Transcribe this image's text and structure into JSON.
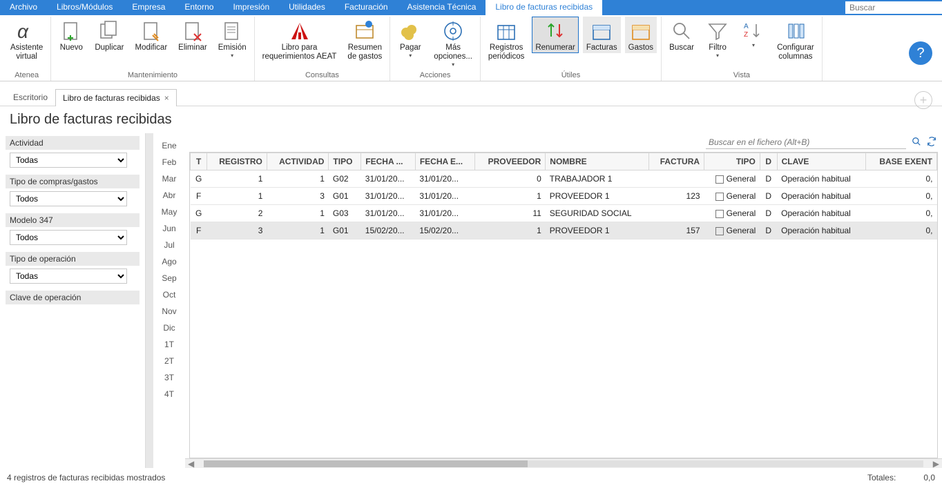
{
  "menubar": {
    "items": [
      "Archivo",
      "Libros/Módulos",
      "Empresa",
      "Entorno",
      "Impresión",
      "Utilidades",
      "Facturación",
      "Asistencia Técnica"
    ],
    "active_tab": "Libro de facturas recibidas",
    "search_placeholder": "Buscar"
  },
  "ribbon": {
    "groups": [
      {
        "label": "Atenea",
        "buttons": [
          {
            "id": "asistente",
            "label": "Asistente\nvirtual"
          }
        ]
      },
      {
        "label": "Mantenimiento",
        "buttons": [
          {
            "id": "nuevo",
            "label": "Nuevo"
          },
          {
            "id": "duplicar",
            "label": "Duplicar"
          },
          {
            "id": "modificar",
            "label": "Modificar"
          },
          {
            "id": "eliminar",
            "label": "Eliminar"
          },
          {
            "id": "emision",
            "label": "Emisión",
            "dd": true
          }
        ]
      },
      {
        "label": "Consultas",
        "buttons": [
          {
            "id": "aeat",
            "label": "Libro para\nrequerimientos AEAT"
          },
          {
            "id": "resumen",
            "label": "Resumen\nde gastos"
          }
        ]
      },
      {
        "label": "Acciones",
        "buttons": [
          {
            "id": "pagar",
            "label": "Pagar",
            "dd": true
          },
          {
            "id": "mas",
            "label": "Más\nopciones...",
            "dd": true
          }
        ]
      },
      {
        "label": "Útiles",
        "buttons": [
          {
            "id": "periodicos",
            "label": "Registros\nperiódicos"
          },
          {
            "id": "renumerar",
            "label": "Renumerar",
            "focus": true
          },
          {
            "id": "facturas",
            "label": "Facturas",
            "focus2": true
          },
          {
            "id": "gastos",
            "label": "Gastos",
            "focus2": true
          }
        ]
      },
      {
        "label": "Vista",
        "buttons": [
          {
            "id": "buscar",
            "label": "Buscar"
          },
          {
            "id": "filtro",
            "label": "Filtro",
            "dd": true
          },
          {
            "id": "orden",
            "label": "",
            "dd": true,
            "icononly": "sort"
          },
          {
            "id": "config",
            "label": "Configurar\ncolumnas"
          }
        ]
      }
    ]
  },
  "doc_tabs": {
    "items": [
      {
        "label": "Escritorio",
        "active": false,
        "closable": false
      },
      {
        "label": "Libro de facturas recibidas",
        "active": true,
        "closable": true
      }
    ]
  },
  "page_title": "Libro de facturas recibidas",
  "filters": [
    {
      "label": "Actividad",
      "value": "Todas"
    },
    {
      "label": "Tipo de compras/gastos",
      "value": "Todos"
    },
    {
      "label": "Modelo 347",
      "value": "Todos"
    },
    {
      "label": "Tipo de operación",
      "value": "Todas"
    },
    {
      "label": "Clave de operación",
      "value": ""
    }
  ],
  "months": [
    "Ene",
    "Feb",
    "Mar",
    "Abr",
    "May",
    "Jun",
    "Jul",
    "Ago",
    "Sep",
    "Oct",
    "Nov",
    "Dic",
    "1T",
    "2T",
    "3T",
    "4T"
  ],
  "file_search": {
    "placeholder": "Buscar en el fichero (Alt+B)"
  },
  "grid": {
    "columns": [
      {
        "key": "t",
        "label": "T",
        "align": "c"
      },
      {
        "key": "registro",
        "label": "REGISTRO",
        "align": "r"
      },
      {
        "key": "actividad",
        "label": "ACTIVIDAD",
        "align": "r"
      },
      {
        "key": "tipo",
        "label": "TIPO"
      },
      {
        "key": "fecha",
        "label": "FECHA ..."
      },
      {
        "key": "fechae",
        "label": "FECHA E..."
      },
      {
        "key": "proveedor",
        "label": "PROVEEDOR",
        "align": "r"
      },
      {
        "key": "nombre",
        "label": "NOMBRE"
      },
      {
        "key": "factura",
        "label": "FACTURA",
        "align": "r"
      },
      {
        "key": "tipol",
        "label": "TIPO",
        "align": "r"
      },
      {
        "key": "d",
        "label": "D",
        "align": "c"
      },
      {
        "key": "clave",
        "label": "CLAVE"
      },
      {
        "key": "base",
        "label": "BASE EXENT",
        "align": "r"
      }
    ],
    "rows": [
      {
        "t": "G",
        "registro": "1",
        "actividad": "1",
        "tipo": "G02",
        "fecha": "31/01/20...",
        "fechae": "31/01/20...",
        "proveedor": "0",
        "nombre": "TRABAJADOR 1",
        "factura": "",
        "tipol": "General",
        "d": "D",
        "clave": "Operación habitual",
        "base": "0,"
      },
      {
        "t": "F",
        "registro": "1",
        "actividad": "3",
        "tipo": "G01",
        "fecha": "31/01/20...",
        "fechae": "31/01/20...",
        "proveedor": "1",
        "nombre": "PROVEEDOR 1",
        "factura": "123",
        "tipol": "General",
        "d": "D",
        "clave": "Operación habitual",
        "base": "0,"
      },
      {
        "t": "G",
        "registro": "2",
        "actividad": "1",
        "tipo": "G03",
        "fecha": "31/01/20...",
        "fechae": "31/01/20...",
        "proveedor": "11",
        "nombre": "SEGURIDAD SOCIAL",
        "factura": "",
        "tipol": "General",
        "d": "D",
        "clave": "Operación habitual",
        "base": "0,"
      },
      {
        "t": "F",
        "registro": "3",
        "actividad": "1",
        "tipo": "G01",
        "fecha": "15/02/20...",
        "fechae": "15/02/20...",
        "proveedor": "1",
        "nombre": "PROVEEDOR 1",
        "factura": "157",
        "tipol": "General",
        "d": "D",
        "clave": "Operación habitual",
        "base": "0,",
        "selected": true
      }
    ]
  },
  "status": {
    "left": "4 registros de facturas recibidas mostrados",
    "totals_label": "Totales:",
    "totals_value": "0,0"
  }
}
